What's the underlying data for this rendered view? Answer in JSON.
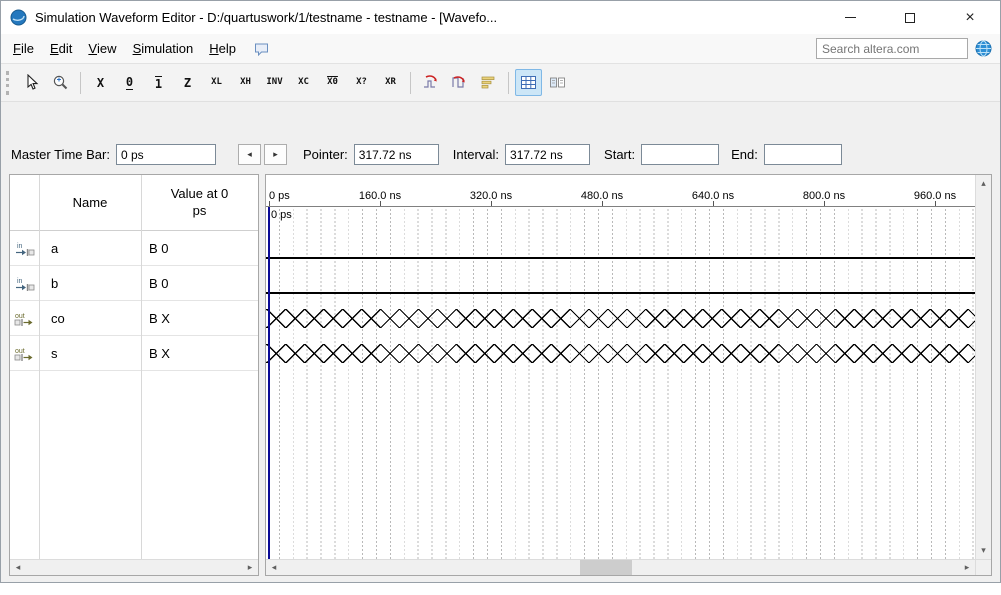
{
  "window": {
    "title": "Simulation Waveform Editor - D:/quartuswork/1/testname - testname - [Wavefo..."
  },
  "icons": {
    "close": "×",
    "left_arrow": "◂",
    "right_arrow": "▸",
    "sb_left": "◂",
    "sb_right": "▸",
    "sb_up": "▴",
    "sb_down": "▾"
  },
  "menu": {
    "items": [
      {
        "label": "File"
      },
      {
        "label": "Edit"
      },
      {
        "label": "View"
      },
      {
        "label": "Simulation"
      },
      {
        "label": "Help"
      }
    ],
    "search_placeholder": "Search altera.com"
  },
  "toolbar": {
    "buttons": [
      {
        "name": "selection-tool",
        "icon": "cursor"
      },
      {
        "name": "zoom-tool",
        "icon": "zoom"
      },
      {
        "sep": true
      },
      {
        "name": "forcing-unknown",
        "glyph": "X"
      },
      {
        "name": "forcing-low",
        "glyph": "0",
        "deco": "under"
      },
      {
        "name": "forcing-high",
        "glyph": "1",
        "deco": "over"
      },
      {
        "name": "forcing-high-impedance",
        "glyph": "Z"
      },
      {
        "name": "weak-low",
        "glyph": "XL"
      },
      {
        "name": "weak-high",
        "glyph": "XH"
      },
      {
        "name": "invert",
        "glyph": "INV"
      },
      {
        "name": "count-value",
        "glyph": "XC"
      },
      {
        "name": "clock",
        "glyph": "X0",
        "deco": "overline"
      },
      {
        "name": "arbitrary-value",
        "glyph": "X?"
      },
      {
        "name": "random-values",
        "glyph": "XR"
      },
      {
        "sep": true
      },
      {
        "name": "snap-to-grid",
        "icon": "snap1"
      },
      {
        "name": "snap-to-transition",
        "icon": "snap2"
      },
      {
        "name": "sort",
        "icon": "sort"
      },
      {
        "sep": true
      },
      {
        "name": "show-grid",
        "icon": "grid",
        "pressed": true
      },
      {
        "name": "show-value-tips",
        "icon": "tips"
      }
    ]
  },
  "timebar": {
    "master_label": "Master Time Bar:",
    "master_value": "0 ps",
    "pointer_label": "Pointer:",
    "pointer_value": "317.72 ns",
    "interval_label": "Interval:",
    "interval_value": "317.72 ns",
    "start_label": "Start:",
    "start_value": "",
    "end_label": "End:",
    "end_value": ""
  },
  "signals": {
    "name_col": "Name",
    "value_col": "Value at 0 ps",
    "rows": [
      {
        "dir": "in",
        "name": "a",
        "value": "B 0",
        "wave": "low"
      },
      {
        "dir": "in",
        "name": "b",
        "value": "B 0",
        "wave": "low"
      },
      {
        "dir": "out",
        "name": "co",
        "value": "B X",
        "wave": "unknown"
      },
      {
        "dir": "out",
        "name": "s",
        "value": "B X",
        "wave": "unknown"
      }
    ]
  },
  "waveform": {
    "ruler_ticks": [
      "0 ps",
      "160.0 ns",
      "320.0 ns",
      "480.0 ns",
      "640.0 ns",
      "800.0 ns",
      "960.0 ns"
    ],
    "cursor_label": "0 ps"
  }
}
